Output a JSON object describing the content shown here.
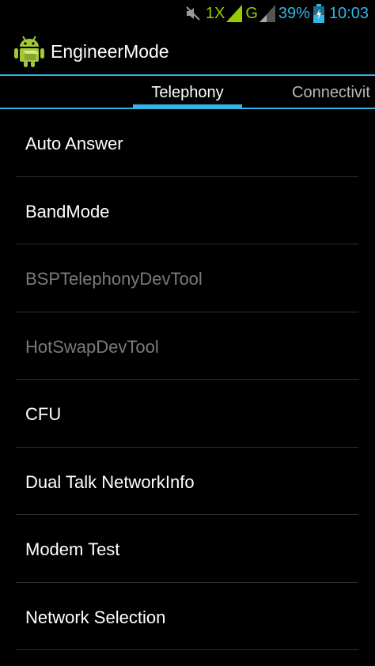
{
  "status_bar": {
    "network_type": "1X",
    "network_type_2": "G",
    "battery_percent": "39%",
    "time": "10:03",
    "icons": [
      "muted-icon",
      "signal-1x-icon",
      "signal-g-icon",
      "battery-charging-icon"
    ]
  },
  "app": {
    "title": "EngineerMode",
    "icon": "android-icon"
  },
  "tabs": [
    {
      "label": "Telephony",
      "selected": true
    },
    {
      "label": "Connectivit",
      "selected": false
    }
  ],
  "list": {
    "items": [
      {
        "label": "Auto Answer",
        "enabled": true
      },
      {
        "label": "BandMode",
        "enabled": true
      },
      {
        "label": "BSPTelephonyDevTool",
        "enabled": false
      },
      {
        "label": "HotSwapDevTool",
        "enabled": false
      },
      {
        "label": "CFU",
        "enabled": true
      },
      {
        "label": "Dual Talk NetworkInfo",
        "enabled": true
      },
      {
        "label": "Modem Test",
        "enabled": true
      },
      {
        "label": "Network Selection",
        "enabled": true
      }
    ]
  },
  "colors": {
    "accent": "#33b5e5",
    "signal": "#99cc00",
    "background": "#000000",
    "disabled_text": "#7a7a7a"
  }
}
